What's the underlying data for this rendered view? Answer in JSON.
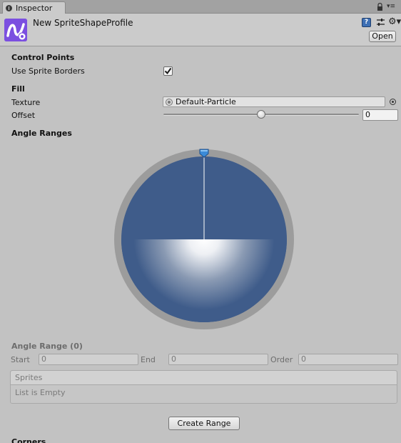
{
  "tab": {
    "label": "Inspector"
  },
  "header": {
    "asset_name": "New SpriteShapeProfile",
    "help_glyph": "?",
    "open_label": "Open"
  },
  "control_points": {
    "section_label": "Control Points",
    "use_sprite_borders_label": "Use Sprite Borders",
    "use_sprite_borders_checked": true
  },
  "fill": {
    "section_label": "Fill",
    "texture_label": "Texture",
    "texture_value": "Default-Particle",
    "offset_label": "Offset",
    "offset_value": "0",
    "offset_slider_fraction": 0.5
  },
  "angle_ranges": {
    "section_label": "Angle Ranges",
    "wheel_colors": {
      "ring": "#9c9c9c",
      "fill": "#3f5c8a",
      "highlight": "#ffffff",
      "handle": "#3b8bd8"
    }
  },
  "angle_range": {
    "title": "Angle Range (0)",
    "start_label": "Start",
    "start_value": "0",
    "end_label": "End",
    "end_value": "0",
    "order_label": "Order",
    "order_value": "0"
  },
  "sprites": {
    "header": "Sprites",
    "empty_text": "List is Empty"
  },
  "create_range_label": "Create Range",
  "corners_label": "Corners",
  "icons": [
    "inspector-tab-icon",
    "lock-icon",
    "tab-menu-icon",
    "sprite-shape-profile-icon",
    "help-icon",
    "preset-icon",
    "settings-icon",
    "texture-object-icon",
    "texture-picker-icon",
    "angle-handle-icon"
  ]
}
